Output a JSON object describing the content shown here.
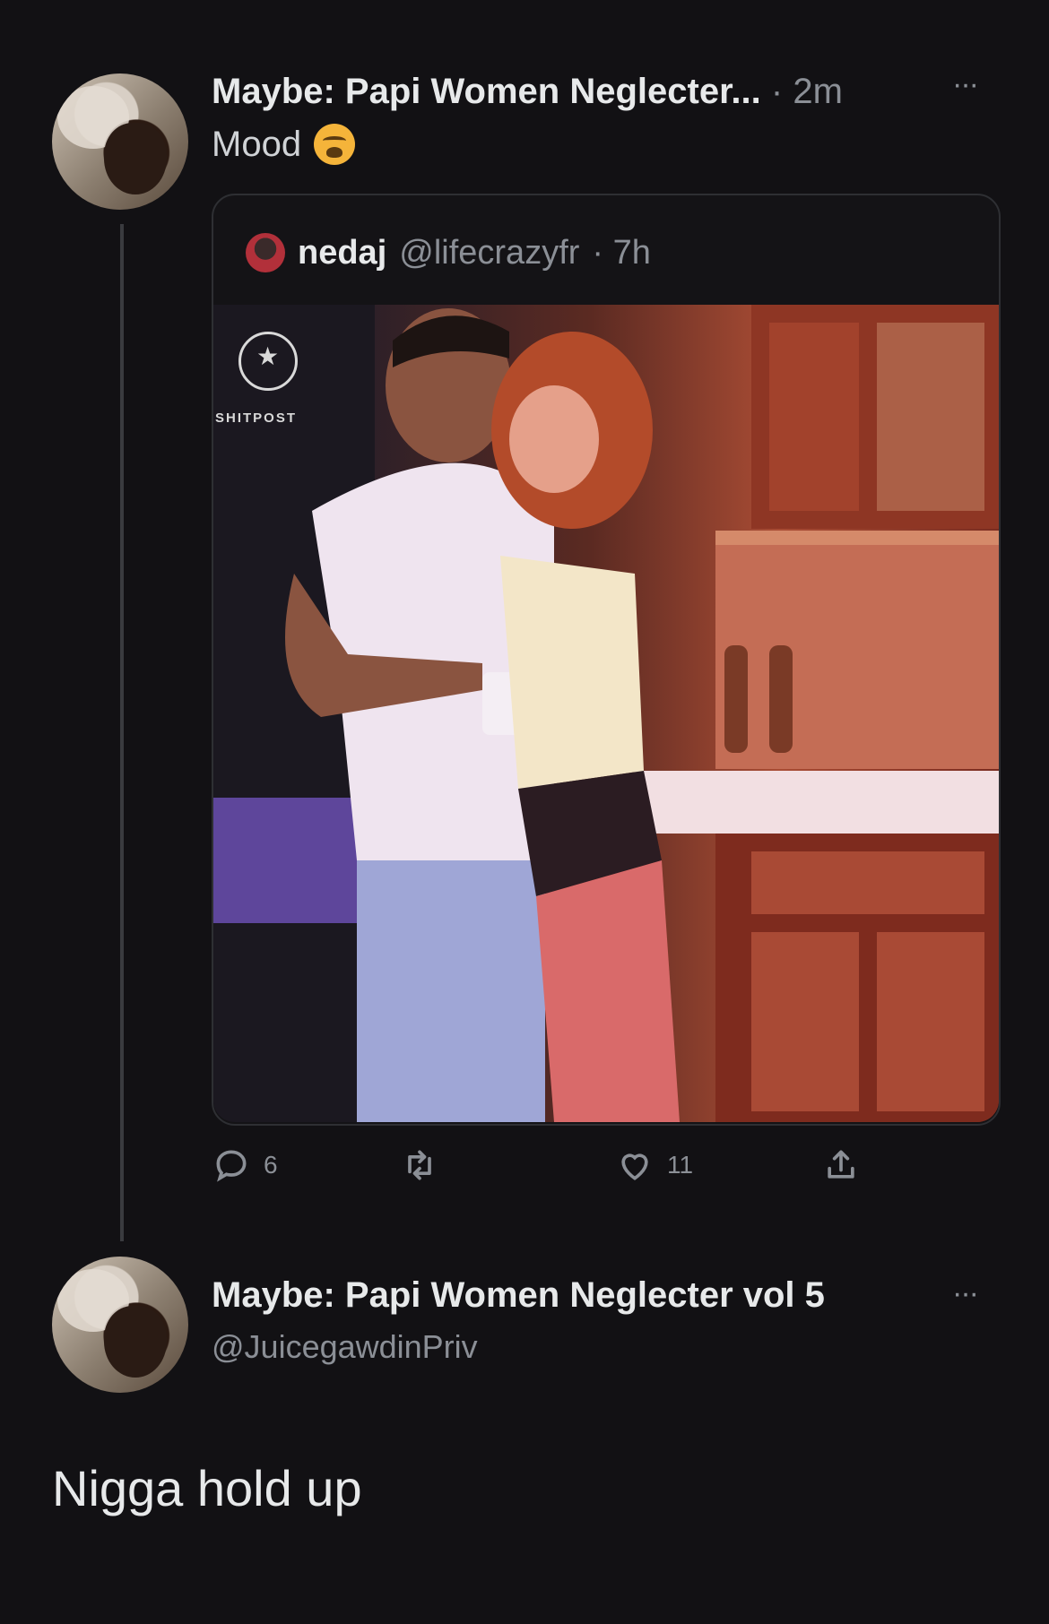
{
  "colors": {
    "background": "#121114",
    "text_primary": "#e7e9ea",
    "text_secondary": "#8b8f96",
    "border": "#2e2f33"
  },
  "tweet": {
    "display_name": "Maybe: Papi Women Neglecter...",
    "time": "· 2m",
    "text": "Mood",
    "emoji": "weary-face-emoji",
    "more_icon": "more-horizontal-icon"
  },
  "quoted_tweet": {
    "display_name": "nedaj",
    "handle": "@lifecrazyfr",
    "time": "· 7h",
    "image_logo_text": "SHITPOST"
  },
  "actions": {
    "reply_count": "6",
    "retweet_count": "",
    "like_count": "11",
    "icons": [
      "reply-icon",
      "retweet-icon",
      "like-icon",
      "share-icon"
    ]
  },
  "reply": {
    "display_name": "Maybe: Papi Women Neglecter vol 5",
    "handle": "@JuicegawdinPriv",
    "text": "Nigga hold up"
  }
}
